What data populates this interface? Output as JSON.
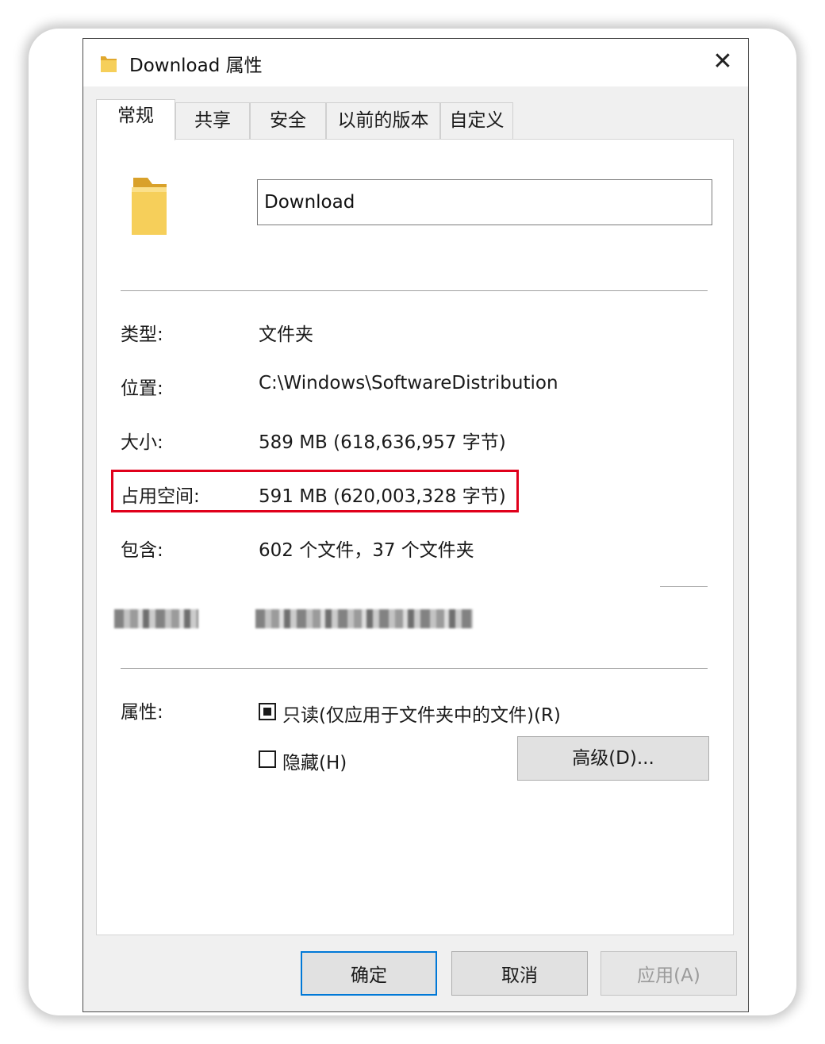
{
  "window": {
    "title": "Download 属性",
    "close_symbol": "✕"
  },
  "tabs": [
    {
      "label": "常规",
      "active": true
    },
    {
      "label": "共享",
      "active": false
    },
    {
      "label": "安全",
      "active": false
    },
    {
      "label": "以前的版本",
      "active": false
    },
    {
      "label": "自定义",
      "active": false
    }
  ],
  "general": {
    "folder_name": "Download",
    "rows": {
      "type": {
        "label": "类型:",
        "value": "文件夹"
      },
      "location": {
        "label": "位置:",
        "value": "C:\\Windows\\SoftwareDistribution"
      },
      "size": {
        "label": "大小:",
        "value": "589 MB (618,636,957 字节)"
      },
      "size_on_disk": {
        "label": "占用空间:",
        "value": "591 MB (620,003,328 字节)"
      },
      "contains": {
        "label": "包含:",
        "value": "602 个文件，37 个文件夹"
      }
    },
    "attributes": {
      "label": "属性:",
      "readonly": {
        "label": "只读(仅应用于文件夹中的文件)(R)",
        "state": "indeterminate"
      },
      "hidden": {
        "label": "隐藏(H)",
        "checked": false
      },
      "advanced_button": "高级(D)..."
    }
  },
  "footer": {
    "ok": "确定",
    "cancel": "取消",
    "apply": "应用(A)"
  },
  "colors": {
    "highlight_box": "#e0001b",
    "primary_button_border": "#0078d7",
    "folder_yellow": "#f3c54b"
  },
  "icons": {
    "title": "folder-icon",
    "large": "folder-icon",
    "close": "close-icon"
  }
}
